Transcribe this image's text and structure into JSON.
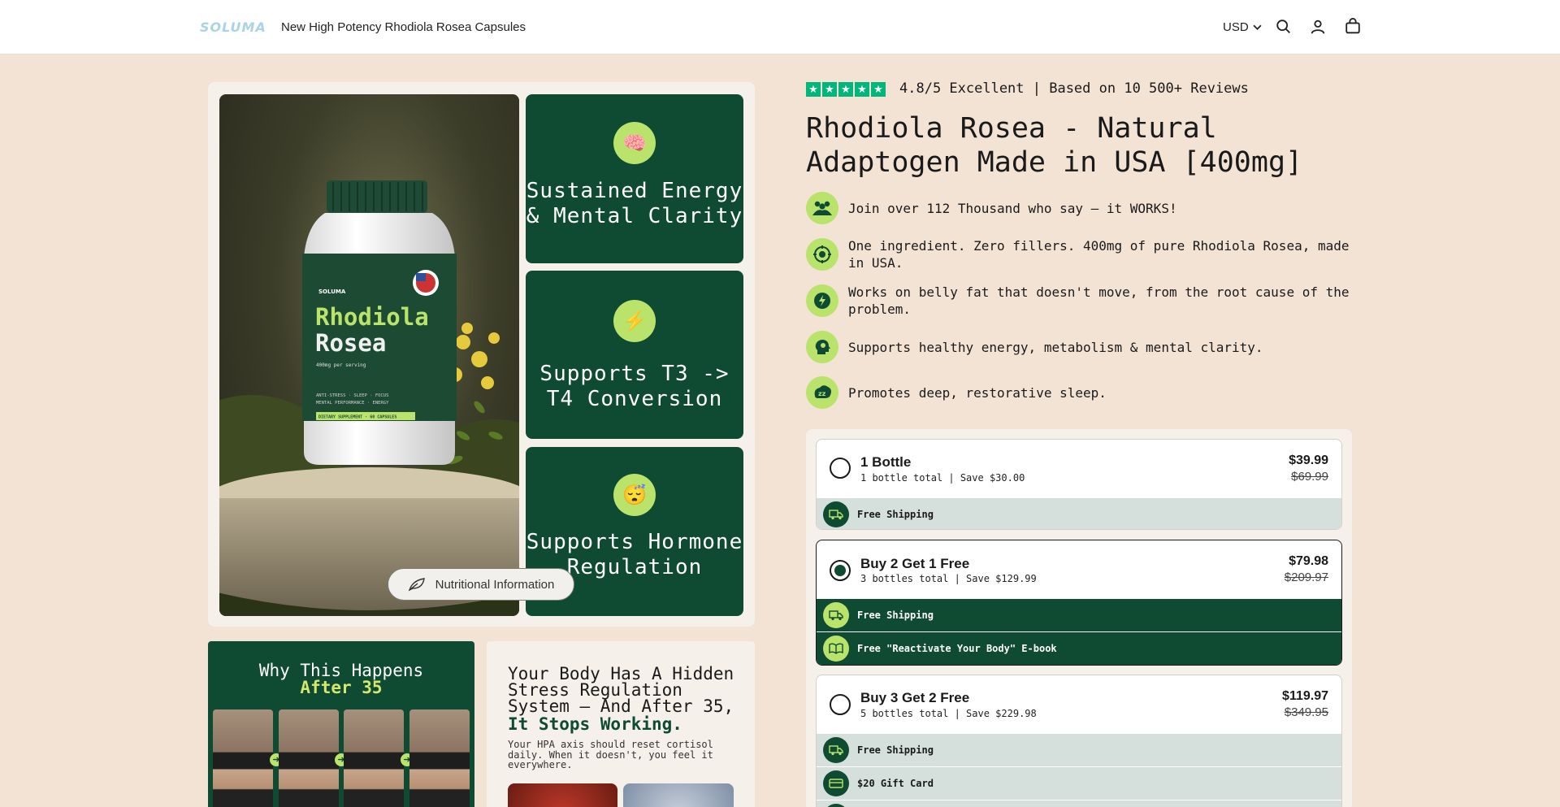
{
  "header": {
    "logo": "SOLUMA",
    "title": "New High Potency Rhodiola Rosea Capsules",
    "currency": "USD"
  },
  "gallery": {
    "tiles": [
      {
        "icon": "🧠",
        "text": "Sustained Energy & Mental Clarity"
      },
      {
        "icon": "⚡",
        "text": "Supports T3 -> T4 Conversion"
      },
      {
        "icon": "😴",
        "text": "Supports Hormone Regulation"
      }
    ],
    "nutrition_button": "Nutritional Information",
    "bottle": {
      "brand": "SOLUMA",
      "name1": "Rhodiola",
      "name2": "Rosea",
      "dose": "400mg per serving",
      "tags1": "ANTI-STRESS · SLEEP · FOCUS",
      "tags2": "MENTAL PERFORMANCE · ENERGY",
      "band": "DIETARY SUPPLEMENT · 60 CAPSULES"
    }
  },
  "why": {
    "line1": "Why This Happens",
    "line2": "After 35"
  },
  "hidden_system": {
    "heading": "Your Body Has A Hidden Stress Regulation System — And After 35,",
    "heading_bold": "It Stops Working.",
    "para": "Your HPA axis should reset cortisol daily. When it doesn't, you feel it everywhere."
  },
  "product": {
    "rating_text": "4.8/5 Excellent | Based on 10 500+ Reviews",
    "title": "Rhodiola Rosea - Natural Adaptogen Made in USA [400mg]",
    "benefits": [
      {
        "icon": "community-icon",
        "text": "Join over 112 Thousand who say — it WORKS!"
      },
      {
        "icon": "molecule-icon",
        "text": "One ingredient. Zero fillers. 400mg of pure Rhodiola Rosea, made in USA."
      },
      {
        "icon": "fat-burn-icon",
        "text": "Works on belly fat that doesn't move, from the root cause of the problem."
      },
      {
        "icon": "brain-head-icon",
        "text": "Supports healthy energy, metabolism & mental clarity."
      },
      {
        "icon": "sleep-icon",
        "text": "Promotes deep, restorative sleep."
      }
    ]
  },
  "offers": [
    {
      "name": "1 Bottle",
      "sub": "1 bottle total | Save $30.00",
      "price": "$39.99",
      "compare": "$69.99",
      "perks": [
        "Free Shipping"
      ],
      "selected": false
    },
    {
      "name": "Buy 2 Get 1 Free",
      "sub": "3 bottles total | Save $129.99",
      "price": "$79.98",
      "compare": "$209.97",
      "perks": [
        "Free Shipping",
        "Free \"Reactivate Your Body\" E-book"
      ],
      "selected": true
    },
    {
      "name": "Buy 3 Get 2 Free",
      "sub": "5 bottles total | Save $229.98",
      "price": "$119.97",
      "compare": "$349.95",
      "perks": [
        "Free Shipping",
        "$20 Gift Card"
      ],
      "selected": false
    }
  ],
  "colors": {
    "brand_green": "#0f4a32",
    "accent_lime": "#b9e36a",
    "trustpilot": "#00b67a",
    "page_bg": "#f3e3d5"
  }
}
